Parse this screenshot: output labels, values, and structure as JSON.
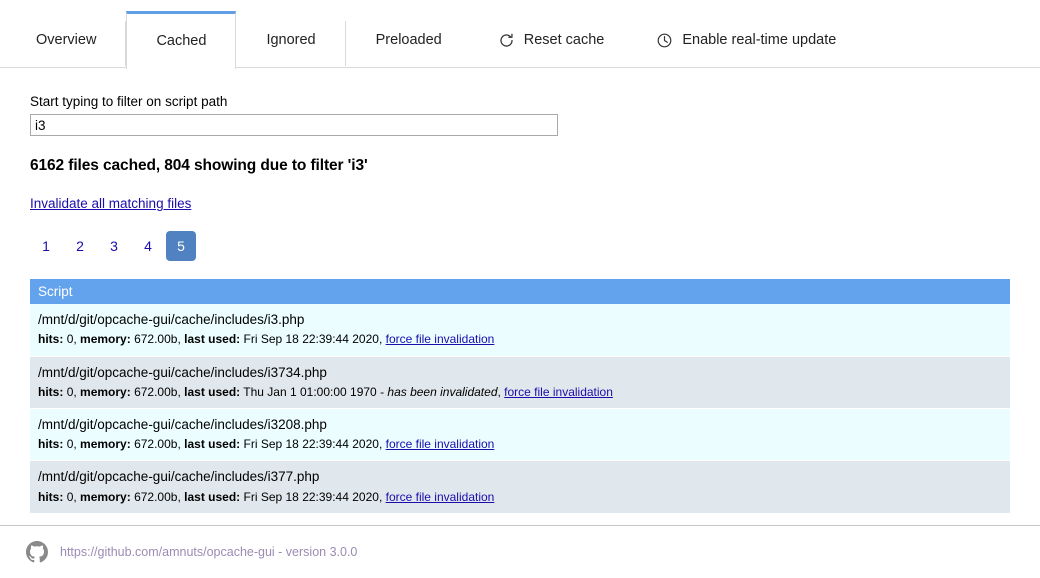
{
  "tabs": [
    {
      "label": "Overview",
      "icon": null,
      "active": false
    },
    {
      "label": "Cached",
      "icon": null,
      "active": true
    },
    {
      "label": "Ignored",
      "icon": null,
      "active": false
    },
    {
      "label": "Preloaded",
      "icon": null,
      "active": false
    },
    {
      "label": "Reset cache",
      "icon": "refresh-icon",
      "active": false
    },
    {
      "label": "Enable real-time update",
      "icon": "clock-icon",
      "active": false
    }
  ],
  "filter": {
    "label": "Start typing to filter on script path",
    "value": "i3",
    "placeholder": ""
  },
  "summary": "6162 files cached, 804 showing due to filter 'i3'",
  "invalidate_all_label": "Invalidate all matching files",
  "pagination": {
    "pages": [
      "1",
      "2",
      "3",
      "4",
      "5"
    ],
    "active": "5"
  },
  "table": {
    "column_header": "Script",
    "meta_labels": {
      "hits": "hits:",
      "memory": "memory:",
      "last_used": "last used:"
    },
    "force_label": "force file invalidation",
    "invalidated_note": "has been invalidated",
    "rows": [
      {
        "path": "/mnt/d/git/opcache-gui/cache/includes/i3.php",
        "hits": "0",
        "memory": "672.00b",
        "last_used": "Fri Sep 18 22:39:44 2020",
        "invalidated": false
      },
      {
        "path": "/mnt/d/git/opcache-gui/cache/includes/i3734.php",
        "hits": "0",
        "memory": "672.00b",
        "last_used": "Thu Jan 1 01:00:00 1970",
        "invalidated": true
      },
      {
        "path": "/mnt/d/git/opcache-gui/cache/includes/i3208.php",
        "hits": "0",
        "memory": "672.00b",
        "last_used": "Fri Sep 18 22:39:44 2020",
        "invalidated": false
      },
      {
        "path": "/mnt/d/git/opcache-gui/cache/includes/i377.php",
        "hits": "0",
        "memory": "672.00b",
        "last_used": "Fri Sep 18 22:39:44 2020",
        "invalidated": false
      }
    ]
  },
  "footer": {
    "icon": "github-icon",
    "link_text": "https://github.com/amnuts/opcache-gui - version 3.0.0"
  },
  "colors": {
    "accent_blue": "#63a2ec",
    "active_tab_border": "#61a0e8",
    "page_active_bg": "#5081c0",
    "row_odd": "#ebfdff",
    "row_even": "#e1e8ed",
    "link": "#1a0dab",
    "footer_link": "#9b8bb4"
  }
}
